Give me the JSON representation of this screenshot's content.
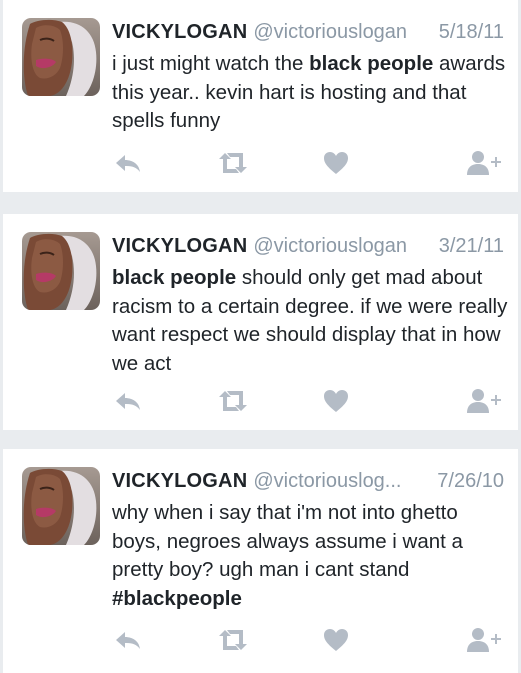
{
  "colors": {
    "background": "#e9ecef",
    "card": "#ffffff",
    "name": "#1f2429",
    "meta": "#8b98a5",
    "icon": "#b4bcc6"
  },
  "icons": [
    "avatar-photo",
    "reply-icon",
    "retweet-icon",
    "heart-icon",
    "follow-icon"
  ],
  "tweets": [
    {
      "name": "VICKYLOGAN",
      "handle": "@victoriouslogan",
      "date": "5/18/11",
      "parts": [
        {
          "t": "i just might watch the ",
          "b": false
        },
        {
          "t": "black people",
          "b": true
        },
        {
          "t": " awards this year.. kevin hart is hosting and that spells funny",
          "b": false
        }
      ]
    },
    {
      "name": "VICKYLOGAN",
      "handle": "@victoriouslogan",
      "date": "3/21/11",
      "parts": [
        {
          "t": "black people",
          "b": true
        },
        {
          "t": " should only get mad about racism to a certain degree. if we were really want respect we should display that in how we act",
          "b": false
        }
      ]
    },
    {
      "name": "VICKYLOGAN",
      "handle": "@victoriouslog...",
      "date": "7/26/10",
      "parts": [
        {
          "t": "why when i say that i'm not into ghetto boys, negroes always assume i want a pretty boy? ugh man i cant stand ",
          "b": false
        },
        {
          "t": "#blackpeople",
          "b": true
        }
      ]
    }
  ]
}
